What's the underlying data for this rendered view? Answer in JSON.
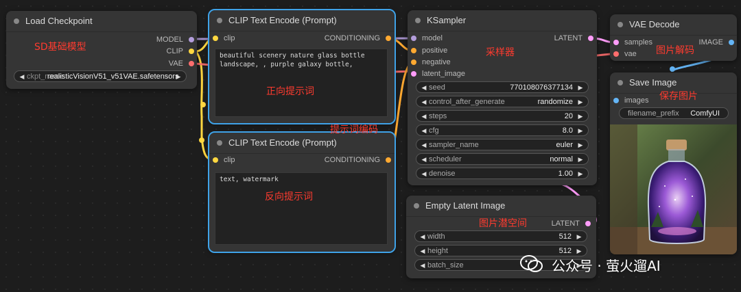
{
  "colors": {
    "model": "#b39ddb",
    "clip": "#ffd740",
    "vae": "#ff6e6e",
    "conditioning": "#ffa931",
    "latent": "#ff9cf9",
    "image": "#64b5f6",
    "selected": "#3fa3e9",
    "annotation": "#ff3b2f"
  },
  "load_checkpoint": {
    "title": "Load Checkpoint",
    "outputs": [
      "MODEL",
      "CLIP",
      "VAE"
    ],
    "ckpt_label": "ckpt_name",
    "ckpt_value": "realisticVisionV51_v51VAE.safetensors"
  },
  "clip_pos": {
    "title": "CLIP Text Encode (Prompt)",
    "input": "clip",
    "output": "CONDITIONING",
    "text": "beautiful scenery nature glass bottle\nlandscape, , purple galaxy bottle,"
  },
  "clip_neg": {
    "title": "CLIP Text Encode (Prompt)",
    "input": "clip",
    "output": "CONDITIONING",
    "text": "text, watermark"
  },
  "ksampler": {
    "title": "KSampler",
    "inputs": [
      "model",
      "positive",
      "negative",
      "latent_image"
    ],
    "output": "LATENT",
    "widgets": [
      {
        "label": "seed",
        "value": "770108076377134"
      },
      {
        "label": "control_after_generate",
        "value": "randomize"
      },
      {
        "label": "steps",
        "value": "20"
      },
      {
        "label": "cfg",
        "value": "8.0"
      },
      {
        "label": "sampler_name",
        "value": "euler"
      },
      {
        "label": "scheduler",
        "value": "normal"
      },
      {
        "label": "denoise",
        "value": "1.00"
      }
    ]
  },
  "empty_latent": {
    "title": "Empty Latent Image",
    "output": "LATENT",
    "widgets": [
      {
        "label": "width",
        "value": "512"
      },
      {
        "label": "height",
        "value": "512"
      },
      {
        "label": "batch_size",
        "value": ""
      }
    ]
  },
  "vae_decode": {
    "title": "VAE Decode",
    "inputs": [
      "samples",
      "vae"
    ],
    "output": "IMAGE"
  },
  "save_image": {
    "title": "Save Image",
    "input": "images",
    "prefix_label": "filename_prefix",
    "prefix_value": "ComfyUI",
    "preview_icon": "galaxy-bottle-preview-image"
  },
  "annotations": {
    "sd_model": "SD基础模型",
    "positive_prompt": "正向提示词",
    "prompt_encoding": "提示词编码",
    "negative_prompt": "反向提示词",
    "sampler": "采样器",
    "image_decode": "图片解码",
    "save_image": "保存图片",
    "latent_space": "图片潜空间"
  },
  "watermark": "公众号 · 萤火遛AI"
}
